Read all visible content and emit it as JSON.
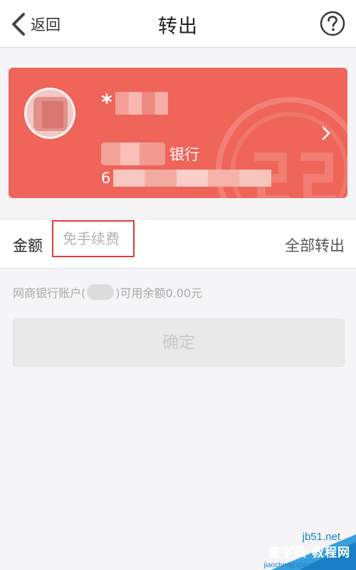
{
  "navbar": {
    "back_label": "返回",
    "title": "转出",
    "icons": {
      "back": "chevron-left-icon",
      "help": "help-circle-icon"
    }
  },
  "card": {
    "color": "#ef6559",
    "name_visible": "*",
    "bank_suffix": "银行",
    "account_prefix": "6",
    "icons": {
      "chevron": "chevron-right-icon"
    }
  },
  "amount": {
    "label": "金额",
    "placeholder": "免手续费",
    "transfer_all": "全部转出",
    "highlight_color": "#e23a3a"
  },
  "balance": {
    "prefix": "网商银行账户(",
    "suffix": ")可用余额0.00元"
  },
  "confirm": {
    "label": "确定"
  },
  "watermark": {
    "line1": "jb51.net",
    "line2": "查字典 教程网",
    "line3": "jiaocheng.chazidian.com"
  }
}
